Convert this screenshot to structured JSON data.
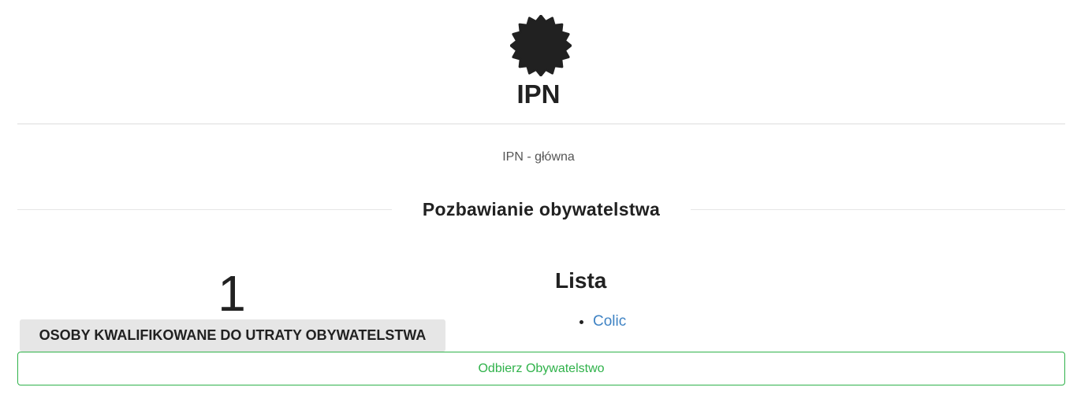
{
  "header": {
    "logo_icon": "seal-badge-icon",
    "title": "IPN"
  },
  "breadcrumb": {
    "label": "IPN - główna"
  },
  "section": {
    "heading": "Pozbawianie obywatelstwa"
  },
  "counter": {
    "value": "1",
    "label": "OSOBY KWALIFIKOWANE DO UTRATY OBYWATELSTWA"
  },
  "list": {
    "title": "Lista",
    "items": [
      {
        "label": "Colic"
      }
    ]
  },
  "action": {
    "label": "Odbierz Obywatelstwo"
  },
  "colors": {
    "accent_green": "#2fb24a",
    "link_blue": "#3f83c4",
    "text_dark": "#212121"
  }
}
